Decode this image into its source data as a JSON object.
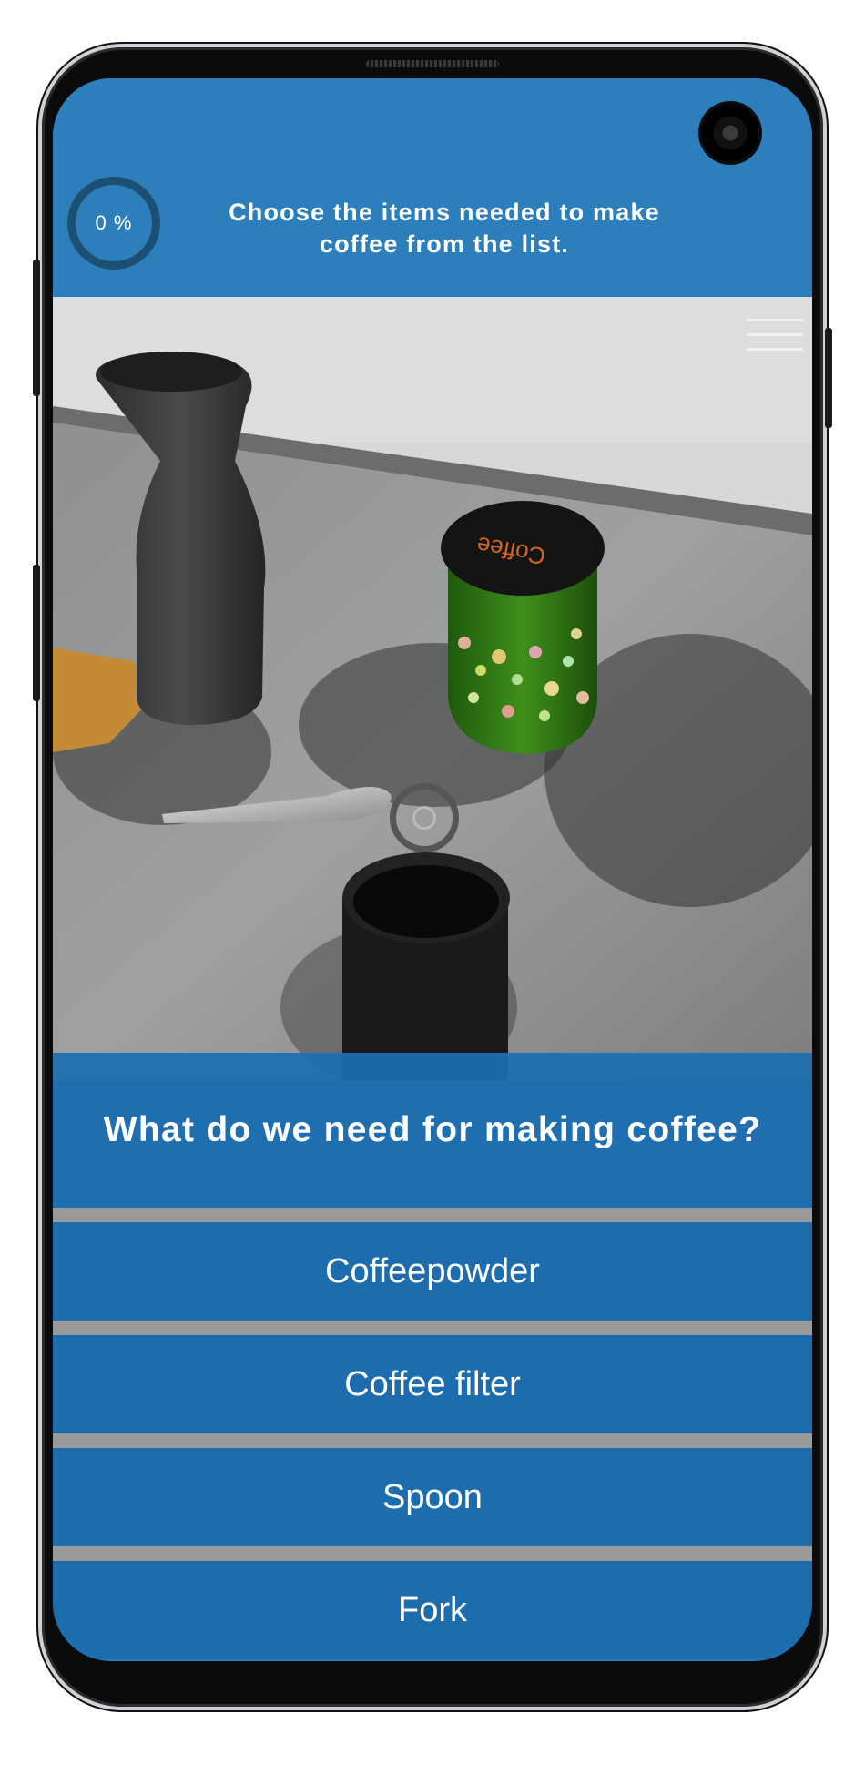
{
  "header": {
    "progress": "0 %",
    "progress_value": 0,
    "instruction_line1": "Choose the items needed to make",
    "instruction_line2": "coffee from the list."
  },
  "scene": {
    "jar_label": "Coffee"
  },
  "quiz": {
    "question": "What do we need for making coffee?",
    "answers": [
      "Coffeepowder",
      "Coffee filter",
      "Spoon",
      "Fork"
    ]
  },
  "colors": {
    "header_blue": "#2c7fbb",
    "panel_blue": "#1e6eaf",
    "jar_green": "#2f7a14"
  }
}
